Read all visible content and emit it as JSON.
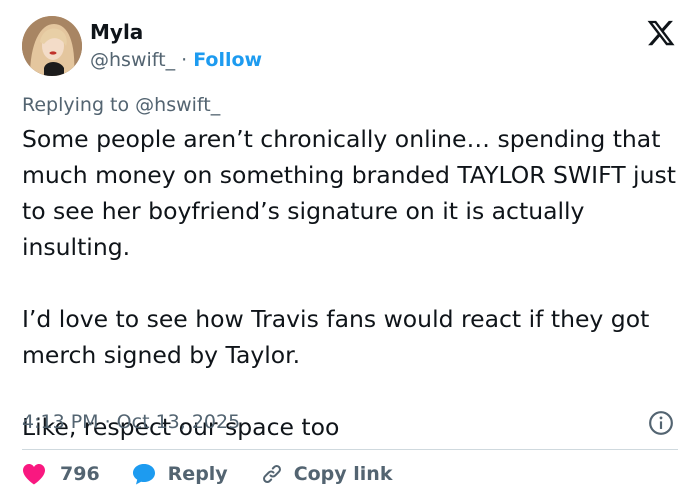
{
  "author": {
    "name": "Myla",
    "handle": "@hswift_",
    "separator": "·",
    "follow_label": "Follow"
  },
  "replying_to": "Replying to @hswift_",
  "body": {
    "paragraphs": [
      "Some people aren’t chronically online… spending that much money on something branded TAYLOR SWIFT just to see her boyfriend’s signature on it is actually insulting.",
      "I’d love to see how Travis fans would react if they got merch signed by Taylor.",
      "Like, respect our space too"
    ]
  },
  "meta": {
    "timestamp": "4:13 PM · Oct 13, 2025"
  },
  "actions": {
    "like_count": "796",
    "reply_label": "Reply",
    "copy_label": "Copy link"
  },
  "colors": {
    "accent": "#1d9bf0",
    "like": "#f91880",
    "muted": "#536471",
    "text": "#0f1419"
  }
}
